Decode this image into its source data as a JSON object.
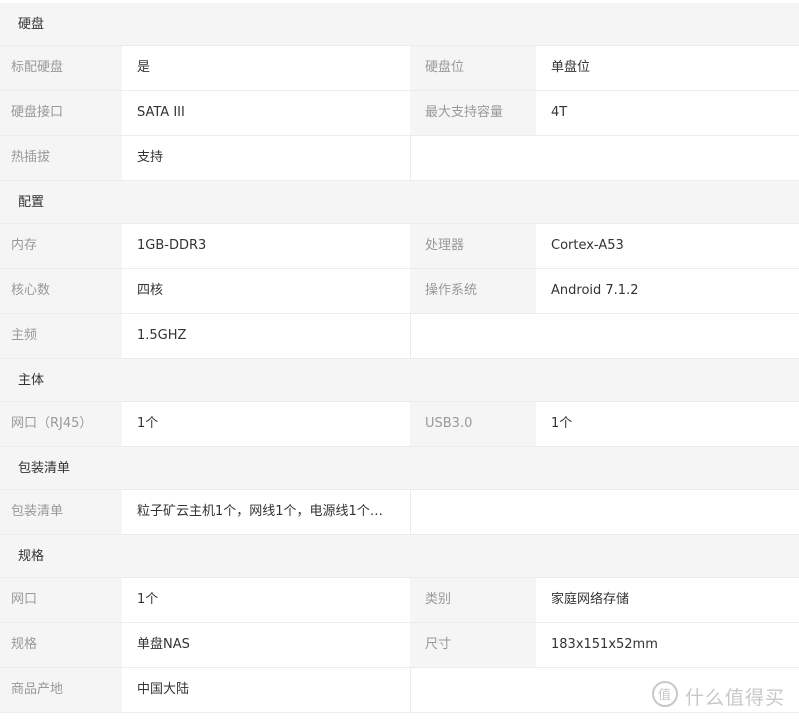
{
  "sections": [
    {
      "title": "硬盘",
      "rows": [
        [
          "标配硬盘",
          "是",
          "硬盘位",
          "单盘位"
        ],
        [
          "硬盘接口",
          "SATA III",
          "最大支持容量",
          "4T"
        ],
        [
          "热插拔",
          "支持",
          "",
          ""
        ]
      ]
    },
    {
      "title": "配置",
      "rows": [
        [
          "内存",
          "1GB-DDR3",
          "处理器",
          "Cortex-A53"
        ],
        [
          "核心数",
          "四核",
          "操作系统",
          "Android 7.1.2"
        ],
        [
          "主频",
          "1.5GHZ",
          "",
          ""
        ]
      ]
    },
    {
      "title": "主体",
      "rows": [
        [
          "网口（RJ45）",
          "1个",
          "USB3.0",
          "1个"
        ]
      ]
    },
    {
      "title": "包装清单",
      "rows": [
        [
          "包装清单",
          "粒子矿云主机1个，网线1个，电源线1个…",
          "",
          ""
        ]
      ]
    },
    {
      "title": "规格",
      "rows": [
        [
          "网口",
          "1个",
          "类别",
          "家庭网络存储"
        ],
        [
          "规格",
          "单盘NAS",
          "尺寸",
          "183x151x52mm"
        ],
        [
          "商品产地",
          "中国大陆",
          "",
          ""
        ]
      ]
    }
  ],
  "watermark": {
    "text": "什么值得买",
    "icon": "zhide-logo-icon"
  }
}
